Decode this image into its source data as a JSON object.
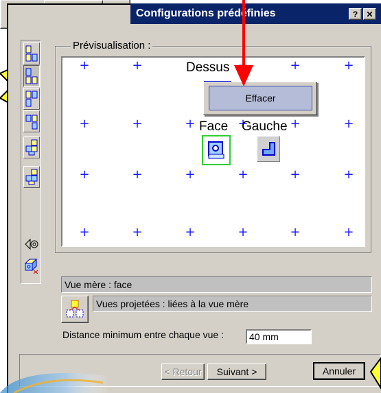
{
  "top_dialog": {
    "cancel_label": "Annuler"
  },
  "window": {
    "title": "Configurations prédéfinies",
    "help_btn": "?",
    "close_btn": "✕"
  },
  "preview": {
    "legend": "Prévisualisation :",
    "views": {
      "top": "Dessus",
      "front": "Face",
      "left": "Gauche"
    }
  },
  "context_menu": {
    "items": [
      "Effacer"
    ]
  },
  "toolbar": {
    "icons": [
      "config-front-left-icon",
      "config-front-top-icon",
      "config-front-bottom-icon",
      "config-left-right-icon",
      "config-iso-a-icon",
      "config-iso-b-icon",
      "orientation-icon",
      "projection-icon"
    ]
  },
  "parent_view": {
    "label": "Vue mère : face"
  },
  "projected_views": {
    "label": "Vues projetées : liées à la vue mère"
  },
  "min_distance": {
    "label": "Distance minimum entre chaque vue :",
    "value": "40 mm"
  },
  "footer": {
    "back_label": "< Retour",
    "next_label": "Suivant >",
    "cancel_label": "Annuler"
  },
  "colors": {
    "title_bar": "#0a246a",
    "accent_arrow": "#ff0000",
    "callout": "#ffff33",
    "plus": "#1a1aff"
  }
}
